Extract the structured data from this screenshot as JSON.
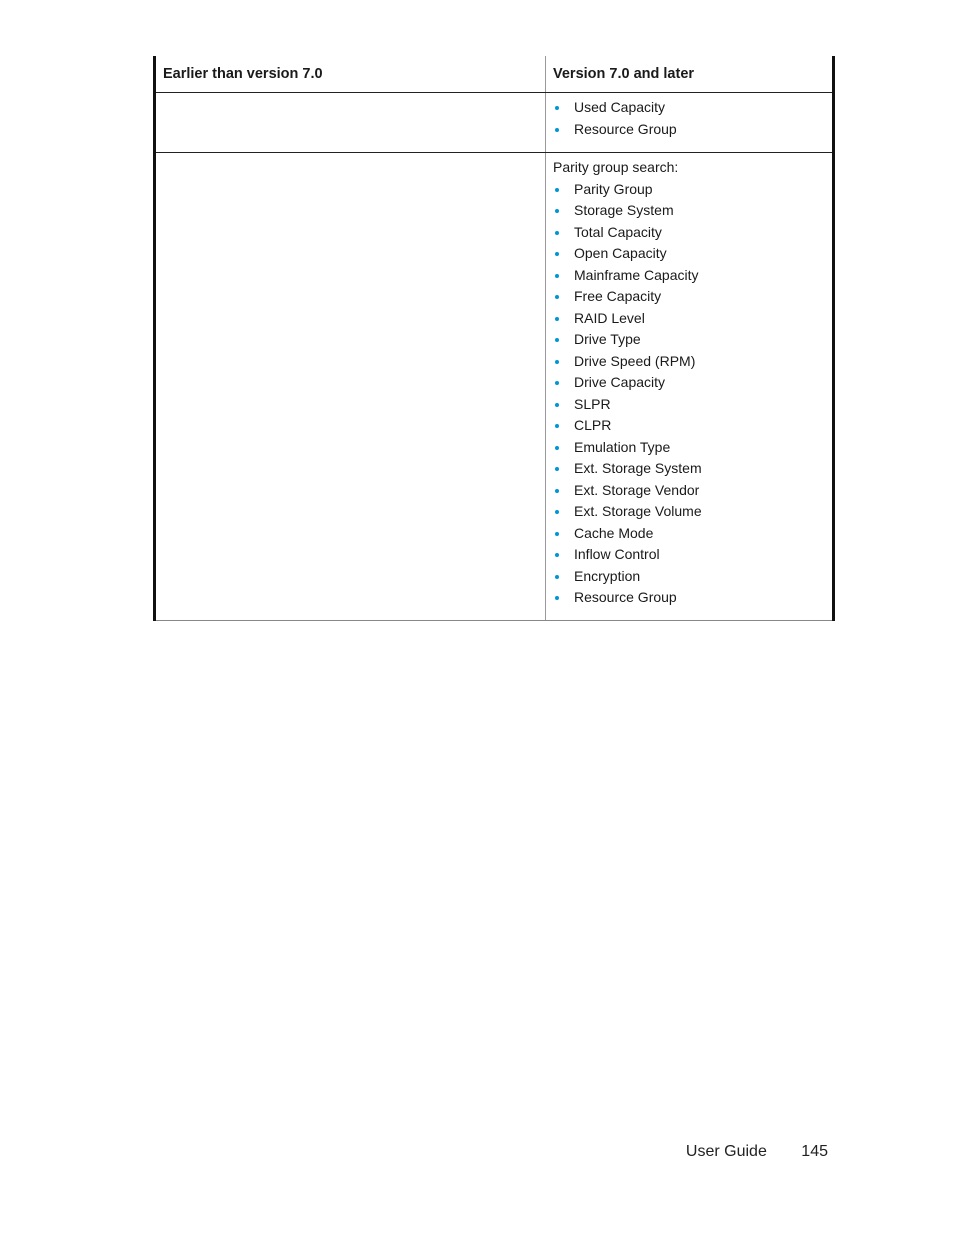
{
  "table": {
    "headers": [
      "Earlier than version 7.0",
      "Version 7.0 and later"
    ],
    "rows": [
      {
        "col1": "",
        "col2_intro": "",
        "col2_items": [
          "Used Capacity",
          "Resource Group"
        ]
      },
      {
        "col1": "",
        "col2_intro": "Parity group search:",
        "col2_items": [
          "Parity Group",
          "Storage System",
          "Total Capacity",
          "Open Capacity",
          "Mainframe Capacity",
          "Free Capacity",
          "RAID Level",
          "Drive Type",
          "Drive Speed (RPM)",
          "Drive Capacity",
          "SLPR",
          "CLPR",
          "Emulation Type",
          "Ext. Storage System",
          "Ext. Storage Vendor",
          "Ext. Storage Volume",
          "Cache Mode",
          "Inflow Control",
          "Encryption",
          "Resource Group"
        ]
      }
    ]
  },
  "colors": {
    "bullet": "#0096d6"
  },
  "footer": {
    "label": "User Guide",
    "page_number": "145"
  }
}
